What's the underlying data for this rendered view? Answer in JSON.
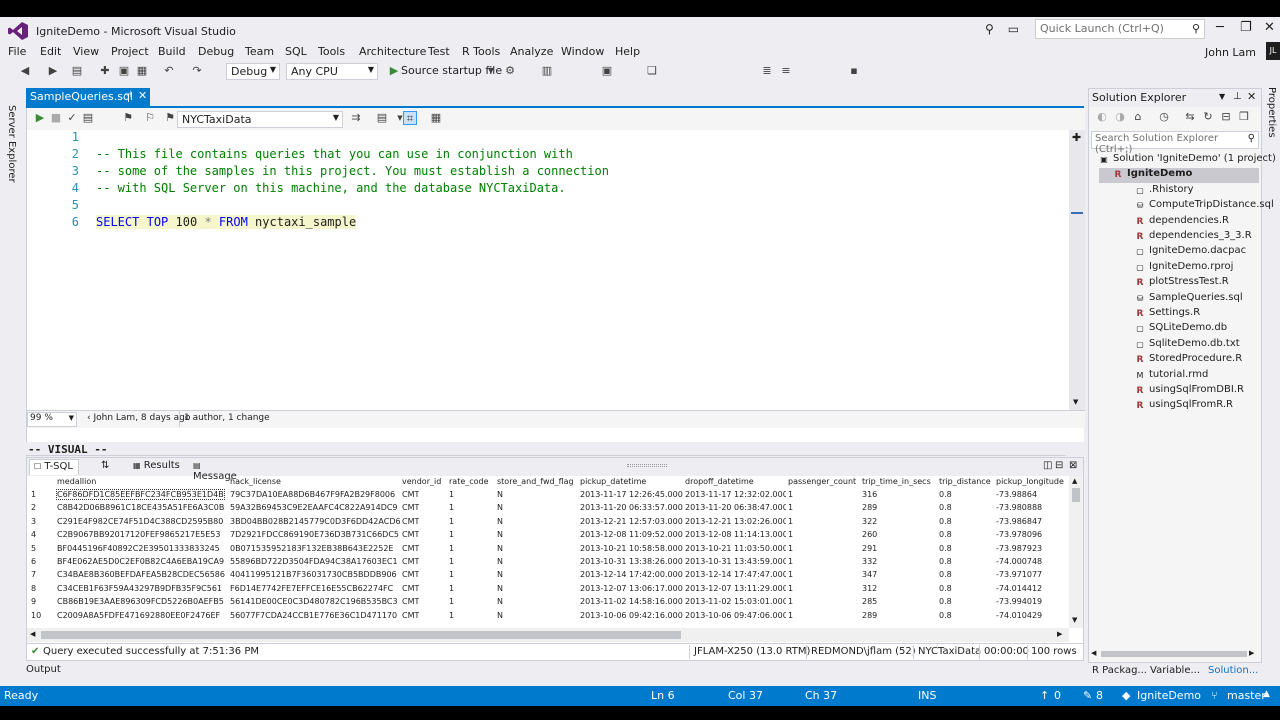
{
  "window": {
    "title": "IgniteDemo - Microsoft Visual Studio",
    "quick_launch_placeholder": "Quick Launch (Ctrl+Q)",
    "user_name": "John Lam",
    "user_initials": "JL"
  },
  "menu": [
    "File",
    "Edit",
    "View",
    "Project",
    "Build",
    "Debug",
    "Team",
    "SQL",
    "Tools",
    "Architecture",
    "Test",
    "R Tools",
    "Analyze",
    "Window",
    "Help"
  ],
  "toolbar": {
    "config": "Debug",
    "platform": "Any CPU",
    "start_label": "Source startup file"
  },
  "side_labels": {
    "left": "Server Explorer",
    "right": "Properties"
  },
  "document_tab": {
    "label": "SampleQueries.sql"
  },
  "sql_toolbar": {
    "database": "NYCTaxiData"
  },
  "code_lines": [
    {
      "num": "1",
      "text": ""
    },
    {
      "num": "2",
      "text": "-- This file contains queries that you can use in conjunction with"
    },
    {
      "num": "3",
      "text": "-- some of the samples in this project. You must establish a connection"
    },
    {
      "num": "4",
      "text": "-- with SQL Server on this machine, and the database NYCTaxiData."
    },
    {
      "num": "5",
      "text": ""
    },
    {
      "num": "6",
      "text": "SELECT TOP 100 * FROM nyctaxi_sample"
    }
  ],
  "editor_status": {
    "zoom": "99 %",
    "author_info": "John Lam, 8 days ago",
    "change_info": "1 author, 1 change"
  },
  "visual_label": "-- VISUAL --",
  "results_tabs": {
    "tsql": "T-SQL",
    "results": "Results",
    "message": "Message"
  },
  "grid": {
    "columns": [
      "medallion",
      "hack_license",
      "vendor_id",
      "rate_code",
      "store_and_fwd_flag",
      "pickup_datetime",
      "dropoff_datetime",
      "passenger_count",
      "trip_time_in_secs",
      "trip_distance",
      "pickup_longitude"
    ],
    "rows": [
      [
        "1",
        "C6F86DFD1C85EEFBFC234FCB953E1D4B",
        "79C37DA10EA88D6B467F9FA2B29F8006",
        "CMT",
        "1",
        "N",
        "2013-11-17 12:26:45.000",
        "2013-11-17 12:32:02.000",
        "1",
        "316",
        "0.8",
        "-73.98864"
      ],
      [
        "2",
        "C8B42D06B8961C18CE435A51FE6A3C0B",
        "59A32B69453C9E2EAAFC4C822A914DC9",
        "CMT",
        "1",
        "N",
        "2013-11-20 06:33:57.000",
        "2013-11-20 06:38:47.000",
        "1",
        "289",
        "0.8",
        "-73.980888"
      ],
      [
        "3",
        "C291E4F982CE74F51D4C388CD2595B80",
        "3BD04BB028B2145779C0D3F6DD42ACD6",
        "CMT",
        "1",
        "N",
        "2013-12-21 12:57:03.000",
        "2013-12-21 13:02:26.000",
        "1",
        "322",
        "0.8",
        "-73.986847"
      ],
      [
        "4",
        "C2B9067BB92017120FEF9865217E5E53",
        "7D2921FDCC869190E736D3B731C66DC5",
        "CMT",
        "1",
        "N",
        "2013-12-08 11:09:52.000",
        "2013-12-08 11:14:13.000",
        "1",
        "260",
        "0.8",
        "-73.978096"
      ],
      [
        "5",
        "BF0445196F40892C2E39501333833245",
        "0B071535952183F132EB38B643E2252E",
        "CMT",
        "1",
        "N",
        "2013-10-21 10:58:58.000",
        "2013-10-21 11:03:50.000",
        "1",
        "291",
        "0.8",
        "-73.987923"
      ],
      [
        "6",
        "BF4E062AE5D0C2EF0B82C4A6EBA19CA9",
        "55896BD722D3504FDA94C38A17603EC1",
        "CMT",
        "1",
        "N",
        "2013-10-31 13:38:26.000",
        "2013-10-31 13:43:59.000",
        "1",
        "332",
        "0.8",
        "-74.000748"
      ],
      [
        "7",
        "C34BAE8B360BEFDAFEA5B28CDEC56586",
        "40411995121B7F36031730CB5BDDB906",
        "CMT",
        "1",
        "N",
        "2013-12-14 17:42:00.000",
        "2013-12-14 17:47:47.000",
        "1",
        "347",
        "0.8",
        "-73.971077"
      ],
      [
        "8",
        "C34CEB1F63F59A43297B9DFB35F9C561",
        "F6D14E7742FE7EFFCE16E55CB62274FC",
        "CMT",
        "1",
        "N",
        "2013-12-07 13:06:17.000",
        "2013-12-07 13:11:29.000",
        "1",
        "312",
        "0.8",
        "-74.014412"
      ],
      [
        "9",
        "CB86B19E3AAE896309FCD5226B0AEFB5",
        "56141DE00CE0C3D480782C196B535BC3",
        "CMT",
        "1",
        "N",
        "2013-11-02 14:58:16.000",
        "2013-11-02 15:03:01.000",
        "1",
        "285",
        "0.8",
        "-73.994019"
      ],
      [
        "10",
        "C2009A8A5FDFE471692880EE0F2476EF",
        "56077F7CDA24CCB1E776E36C1D471170",
        "CMT",
        "1",
        "N",
        "2013-10-06 09:42:16.000",
        "2013-10-06 09:47:06.000",
        "1",
        "289",
        "0.8",
        "-74.010429"
      ]
    ]
  },
  "query_status": {
    "message": "Query executed successfully at 7:51:36 PM",
    "server": "JFLAM-X250 (13.0 RTM)",
    "user": "REDMOND\\jflam (52)",
    "database": "NYCTaxiData",
    "elapsed": "00:00:00",
    "rows": "100 rows"
  },
  "output_tab": "Output",
  "solution_explorer": {
    "title": "Solution Explorer",
    "search_placeholder": "Search Solution Explorer (Ctrl+;)",
    "items": [
      {
        "label": "Solution 'IgniteDemo' (1 project)",
        "icon": "solution-icon",
        "indent": 0
      },
      {
        "label": "IgniteDemo",
        "icon": "r-project-icon",
        "indent": 1
      },
      {
        "label": ".Rhistory",
        "icon": "file-icon",
        "indent": 2
      },
      {
        "label": "ComputeTripDistance.sql",
        "icon": "database-icon",
        "indent": 2
      },
      {
        "label": "dependencies.R",
        "icon": "r-file-icon",
        "indent": 2
      },
      {
        "label": "dependencies_3_3.R",
        "icon": "r-file-icon",
        "indent": 2
      },
      {
        "label": "IgniteDemo.dacpac",
        "icon": "file-icon",
        "indent": 2
      },
      {
        "label": "IgniteDemo.rproj",
        "icon": "file-icon",
        "indent": 2
      },
      {
        "label": "plotStressTest.R",
        "icon": "r-file-icon",
        "indent": 2
      },
      {
        "label": "SampleQueries.sql",
        "icon": "database-icon",
        "indent": 2
      },
      {
        "label": "Settings.R",
        "icon": "r-file-icon",
        "indent": 2
      },
      {
        "label": "SQLiteDemo.db",
        "icon": "file-icon",
        "indent": 2
      },
      {
        "label": "SqliteDemo.db.txt",
        "icon": "file-icon",
        "indent": 2
      },
      {
        "label": "StoredProcedure.R",
        "icon": "r-file-icon",
        "indent": 2
      },
      {
        "label": "tutorial.rmd",
        "icon": "markdown-icon",
        "indent": 2
      },
      {
        "label": "usingSqlFromDBI.R",
        "icon": "r-file-icon",
        "indent": 2
      },
      {
        "label": "usingSqlFromR.R",
        "icon": "r-file-icon",
        "indent": 2
      }
    ],
    "bottom_tabs": [
      "R Packag...",
      "Variable...",
      "Solution..."
    ]
  },
  "statusbar": {
    "state": "Ready",
    "line": "Ln 6",
    "col": "Col 37",
    "ch": "Ch 37",
    "mode": "INS",
    "up_count": "0",
    "edit_count": "8",
    "project": "IgniteDemo",
    "branch": "master"
  },
  "colors": {
    "accent": "#007acc",
    "chrome": "#eeeef2",
    "comment": "#008000",
    "keyword": "#0000ff"
  }
}
